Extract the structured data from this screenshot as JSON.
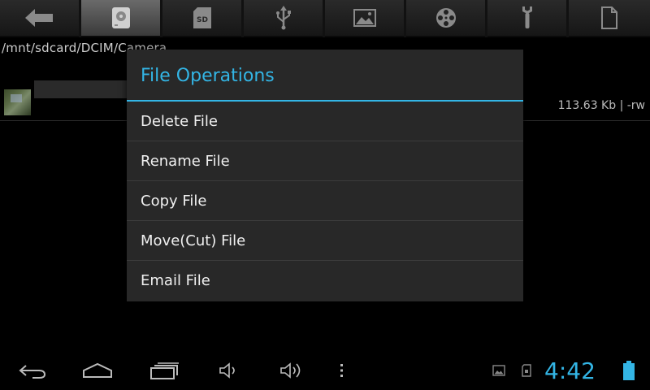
{
  "toolbar": {
    "buttons": [
      {
        "icon": "back-arrow-icon"
      },
      {
        "icon": "internal-storage-icon",
        "active": true
      },
      {
        "icon": "sd-card-icon",
        "label": "SD"
      },
      {
        "icon": "usb-icon"
      },
      {
        "icon": "image-icon"
      },
      {
        "icon": "video-reel-icon"
      },
      {
        "icon": "wrench-icon"
      },
      {
        "icon": "document-icon"
      }
    ]
  },
  "current_path": "/mnt/sdcard/DCIM/Camera",
  "file": {
    "size_permissions": "113.63 Kb  | -rw"
  },
  "dialog": {
    "title": "File Operations",
    "items": [
      {
        "label": "Delete File"
      },
      {
        "label": "Rename File"
      },
      {
        "label": "Copy File"
      },
      {
        "label": "Move(Cut) File"
      },
      {
        "label": "Email File"
      }
    ]
  },
  "navbar": {
    "clock": "4:42"
  },
  "colors": {
    "accent": "#33b5e5",
    "dialog_bg": "#282828",
    "background": "#000000"
  }
}
